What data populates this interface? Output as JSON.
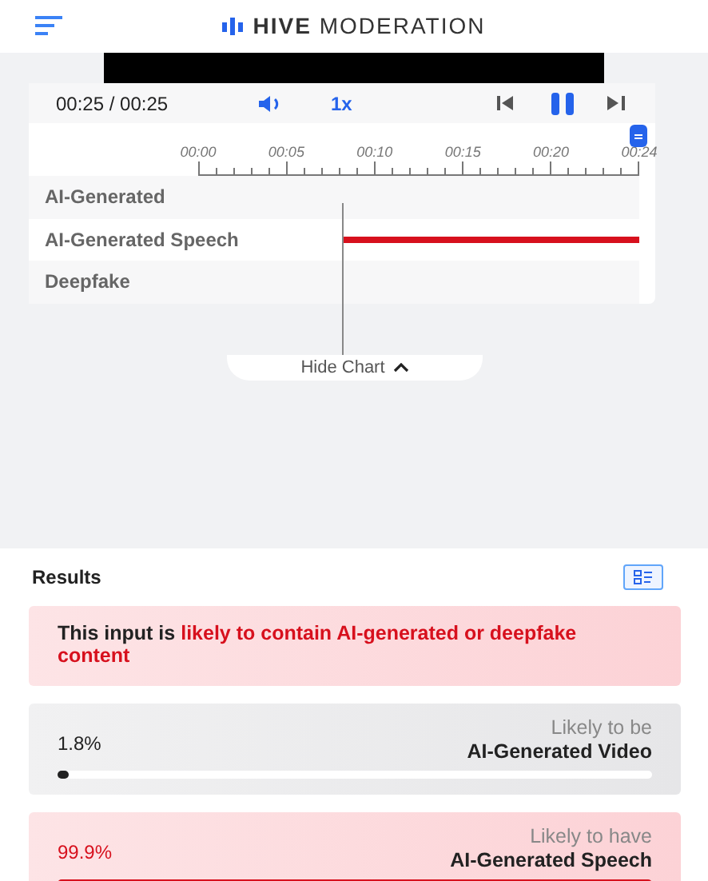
{
  "header": {
    "logo_bold": "HIVE",
    "logo_light": "MODERATION"
  },
  "player": {
    "time": "00:25 / 00:25",
    "speed": "1x",
    "playing": true,
    "ticks": [
      "00:00",
      "00:05",
      "00:10",
      "00:15",
      "00:20",
      "00:24"
    ],
    "tracks": [
      {
        "label": "AI-Generated",
        "flagged": false
      },
      {
        "label": "AI-Generated Speech",
        "flagged": true
      },
      {
        "label": "Deepfake",
        "flagged": false
      }
    ],
    "toggle": "Hide Chart"
  },
  "results": {
    "title": "Results",
    "verdict": "This input is **likely to contain AI-generated or deepfake content**",
    "scores": [
      {
        "value": "1.8%",
        "caption": "Likely to be",
        "label": "AI-Generated Video",
        "level": 0.018,
        "flagged": false
      },
      {
        "value": "99.9%",
        "caption": "Likely to have",
        "label": "AI-Generated Speech",
        "level": 0.999,
        "flagged": true
      }
    ]
  }
}
